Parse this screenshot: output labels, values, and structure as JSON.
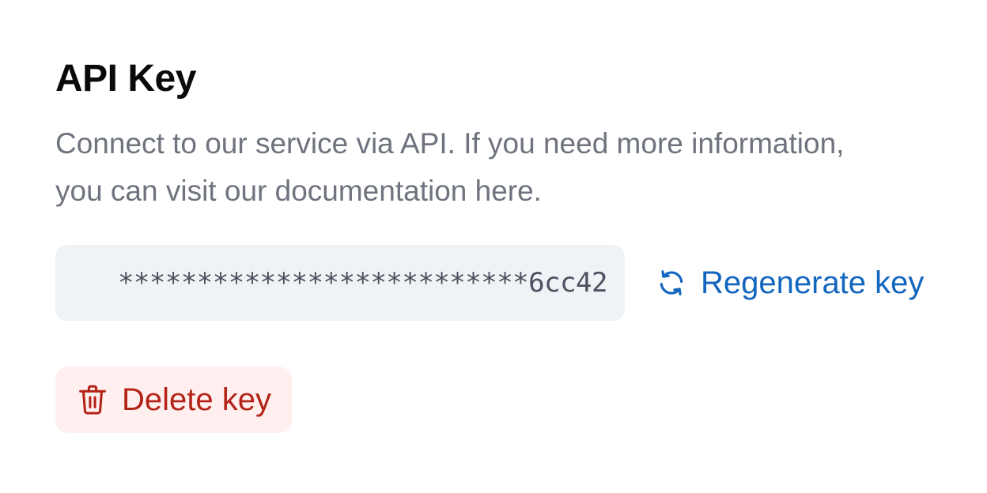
{
  "section": {
    "title": "API Key",
    "description": "Connect to our service via API. If you need more information, you can visit our documentation here."
  },
  "api_key": {
    "masked_value": "**************************6cc42"
  },
  "actions": {
    "regenerate_label": "Regenerate key",
    "regenerate_icon": "refresh-icon",
    "delete_label": "Delete key",
    "delete_icon": "trash-icon"
  },
  "colors": {
    "link_blue": "#1366bf",
    "danger_red": "#b42318",
    "danger_bg": "#fff0ef",
    "field_bg": "#f0f3f6",
    "muted_text": "#6e737e"
  }
}
